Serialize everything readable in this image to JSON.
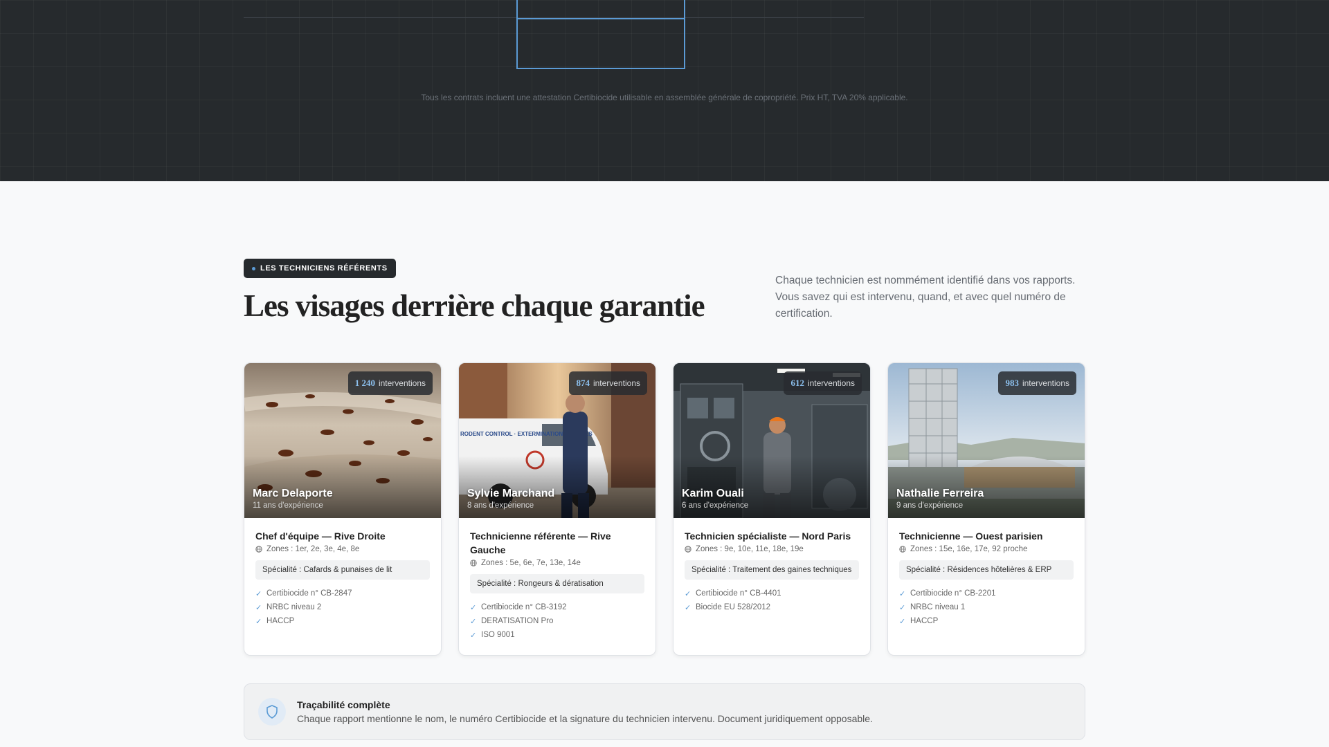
{
  "pricing_note": "Tous les contrats incluent une attestation Certibiocide utilisable en assemblée générale de copropriété. Prix HT, TVA 20% applicable.",
  "team": {
    "eyebrow": "LES TECHNICIENS RÉFÉRENTS",
    "title": "Les visages derrière chaque garantie",
    "intro": "Chaque technicien est nommément identifié dans vos rapports. Vous savez qui est intervenu, quand, et avec quel numéro de certification.",
    "interventions_label": "interventions",
    "members": [
      {
        "interventions": "1 240",
        "name": "Marc Delaporte",
        "experience": "11 ans d'expérience",
        "role": "Chef d'équipe — Rive Droite",
        "zones": "Zones : 1er, 2e, 3e, 4e, 8e",
        "specialty": "Spécialité : Cafards & punaises de lit",
        "certifications": [
          "Certibiocide n° CB-2847",
          "NRBC niveau 2",
          "HACCP"
        ]
      },
      {
        "interventions": "874",
        "name": "Sylvie Marchand",
        "experience": "8 ans d'expérience",
        "role": "Technicienne référente — Rive Gauche",
        "zones": "Zones : 5e, 6e, 7e, 13e, 14e",
        "specialty": "Spécialité : Rongeurs & dératisation",
        "certifications": [
          "Certibiocide n° CB-3192",
          "DERATISATION Pro",
          "ISO 9001"
        ]
      },
      {
        "interventions": "612",
        "name": "Karim Ouali",
        "experience": "6 ans d'expérience",
        "role": "Technicien spécialiste — Nord Paris",
        "zones": "Zones : 9e, 10e, 11e, 18e, 19e",
        "specialty": "Spécialité : Traitement des gaines techniques",
        "certifications": [
          "Certibiocide n° CB-4401",
          "Biocide EU 528/2012"
        ]
      },
      {
        "interventions": "983",
        "name": "Nathalie Ferreira",
        "experience": "9 ans d'expérience",
        "role": "Technicienne — Ouest parisien",
        "zones": "Zones : 15e, 16e, 17e, 92 proche",
        "specialty": "Spécialité : Résidences hôtelières & ERP",
        "certifications": [
          "Certibiocide n° CB-2201",
          "NRBC niveau 1",
          "HACCP"
        ]
      }
    ]
  },
  "van_lettering": "RODENT CONTROL · EXTERMINATION SERVICES",
  "traceability": {
    "title": "Traçabilité complète",
    "description": "Chaque rapport mentionne le nom, le numéro Certibiocide et la signature du technicien intervenu. Document juridiquement opposable."
  },
  "colors": {
    "dark_band": "#262a2d",
    "accent": "#5b9bd5",
    "page_bg": "#f8f9fa"
  }
}
